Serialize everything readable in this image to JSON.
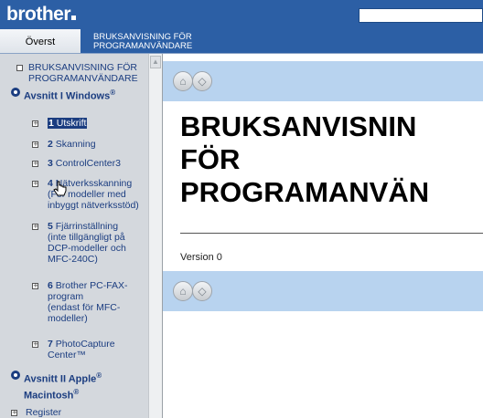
{
  "header": {
    "logo": "brother"
  },
  "tabs": {
    "home": "Överst",
    "manual_line1": "BRUKSANVISNING FÖR",
    "manual_line2": "PROGRAMANVÄNDARE"
  },
  "sidebar": {
    "top_line1": "BRUKSANVISNING FÖR",
    "top_line2": "PROGRAMANVÄNDARE",
    "section1": "Avsnitt I Windows",
    "section1_sup": "®",
    "items": [
      {
        "num": "1",
        "label": "Utskrift"
      },
      {
        "num": "2",
        "label": "Skanning"
      },
      {
        "num": "3",
        "label": "ControlCenter3"
      },
      {
        "num": "4",
        "label": "Nätverksskanning",
        "lines": [
          "(För modeller med",
          "inbyggt nätverksstöd)"
        ]
      },
      {
        "num": "5",
        "label": "Fjärrinställning",
        "lines": [
          "(inte tillgängligt på",
          "DCP-modeller och",
          "MFC-240C)"
        ]
      },
      {
        "num": "6",
        "label": "Brother PC-FAX-",
        "lines": [
          "program",
          "(endast för MFC-",
          "modeller)"
        ]
      },
      {
        "num": "7",
        "label": "PhotoCapture",
        "lines": [
          "Center™"
        ]
      }
    ],
    "section2_line1": "Avsnitt II Apple",
    "section2_sup": "®",
    "section2_line2": "Macintosh",
    "section2_sup2": "®",
    "register": "Register"
  },
  "content": {
    "title_line1": "BRUKSANVISNIN",
    "title_line2": "FÖR",
    "title_line3": "PROGRAMANVÄN",
    "version": "Version 0"
  },
  "colors": {
    "brand": "#2c5fa5",
    "nav_bar": "#b8d3ef",
    "sidebar": "#d4d8dd",
    "link": "#1b3d80"
  }
}
